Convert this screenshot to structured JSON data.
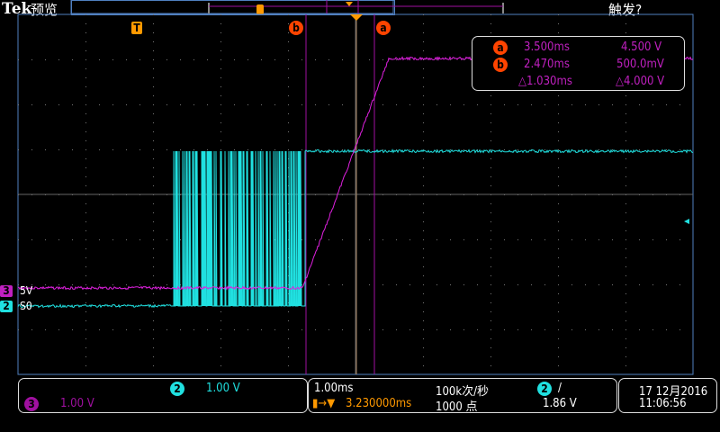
{
  "header": {
    "brand": "Tek",
    "mode": "预览",
    "trigger_status": "触发?"
  },
  "markers": {
    "trigger": "T",
    "cursor_a": "a",
    "cursor_b": "b"
  },
  "channels": {
    "ch3": {
      "num": "3",
      "label": "5V",
      "scale": "1.00 V",
      "color": "#c020c0"
    },
    "ch2": {
      "num": "2",
      "label": "S0",
      "scale": "1.00 V",
      "color": "#20e0e0"
    }
  },
  "cursor_readout": {
    "a_time": "3.500ms",
    "a_volt": "4.500 V",
    "b_time": "2.470ms",
    "b_volt": "500.0mV",
    "delta_time": "△1.030ms",
    "delta_volt": "△4.000 V"
  },
  "timebase": {
    "scale": "1.00ms",
    "sample_rate": "100k次/秒",
    "trigger_pos": "3.230000ms",
    "record_length": "1000 点"
  },
  "trigger": {
    "source": "2",
    "slope": "/",
    "level": "1.86 V"
  },
  "datetime": {
    "date": "17 12月2016",
    "time": "11:06:56"
  },
  "colors": {
    "graticule": "#5080c0",
    "trigger": "#ff9900",
    "cursor": "#ff4400"
  }
}
